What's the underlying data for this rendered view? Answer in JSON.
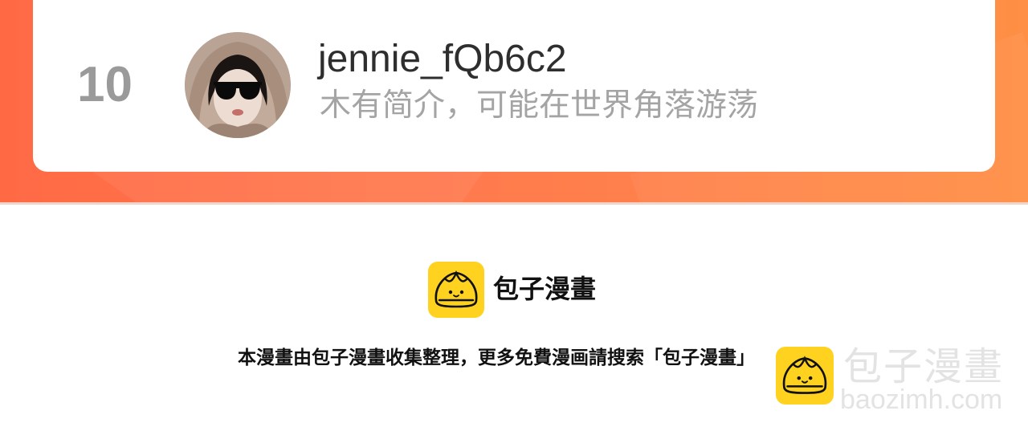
{
  "ranking_entry": {
    "rank": "10",
    "username": "jennie_fQb6c2",
    "bio": "木有简介，可能在世界角落游荡",
    "avatar_icon": "user-avatar-photo"
  },
  "footer": {
    "brand_name": "包子漫畫",
    "brand_icon": "bun-logo-icon",
    "notice": "本漫畫由包子漫畫收集整理，更多免費漫画請搜索「包子漫畫」"
  },
  "watermark": {
    "name": "包子漫畫",
    "url": "baozimh.com",
    "icon": "bun-logo-icon"
  },
  "colors": {
    "banner_start": "#ff6a45",
    "banner_end": "#ff8f45",
    "brand_yellow": "#ffd21f",
    "rank_gray": "#9a9a9a",
    "bio_gray": "#a4a4a4"
  }
}
